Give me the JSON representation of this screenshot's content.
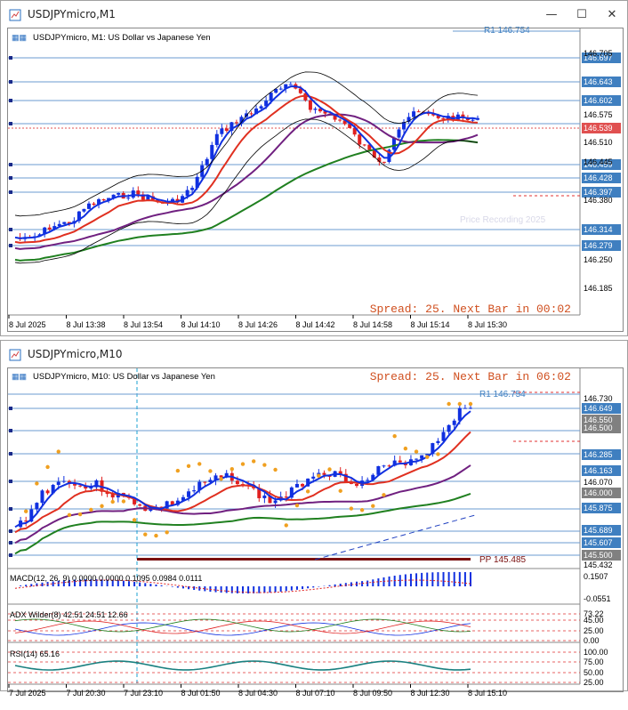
{
  "win1": {
    "title": "USDJPYmicro,M1",
    "chart_title": "USDJPYmicro, M1:  US Dollar vs Japanese Yen",
    "spread_label": "Spread: 25. Next Bar in 00:02",
    "r1_label": "R1 146.754",
    "watermark": "Price Recording 2025",
    "price_tags": [
      {
        "v": "146.697",
        "bg": "#3f7fc0"
      },
      {
        "v": "146.643",
        "bg": "#3f7fc0"
      },
      {
        "v": "146.602",
        "bg": "#3f7fc0"
      },
      {
        "v": "146.539",
        "bg": "#e05050"
      },
      {
        "v": "146.459",
        "bg": "#3f7fc0"
      },
      {
        "v": "146.428",
        "bg": "#3f7fc0"
      },
      {
        "v": "146.397",
        "bg": "#3f7fc0"
      },
      {
        "v": "146.314",
        "bg": "#3f7fc0"
      },
      {
        "v": "146.279",
        "bg": "#3f7fc0"
      }
    ],
    "y_ticks": [
      "146.705",
      "146.575",
      "146.510",
      "146.445",
      "146.380",
      "146.250",
      "146.185"
    ],
    "x_ticks": [
      "8 Jul 2025",
      "8 Jul 13:38",
      "8 Jul 13:54",
      "8 Jul 14:10",
      "8 Jul 14:26",
      "8 Jul 14:42",
      "8 Jul 14:58",
      "8 Jul 15:14",
      "8 Jul 15:30"
    ]
  },
  "win2": {
    "title": "USDJPYmicro,M10",
    "chart_title": "USDJPYmicro, M10:  US Dollar vs Japanese Yen",
    "spread_label": "Spread: 25. Next Bar in 06:02",
    "r1_label": "R1 146.754",
    "pp_label": "PP 145.485",
    "price_tags": [
      {
        "v": "146.649",
        "bg": "#3f7fc0"
      },
      {
        "v": "146.550",
        "bg": "#808080"
      },
      {
        "v": "146.500",
        "bg": "#808080"
      },
      {
        "v": "146.285",
        "bg": "#3f7fc0"
      },
      {
        "v": "146.163",
        "bg": "#3f7fc0"
      },
      {
        "v": "146.000",
        "bg": "#808080"
      },
      {
        "v": "145.875",
        "bg": "#3f7fc0"
      },
      {
        "v": "145.689",
        "bg": "#3f7fc0"
      },
      {
        "v": "145.607",
        "bg": "#3f7fc0"
      },
      {
        "v": "145.500",
        "bg": "#808080"
      }
    ],
    "y_ticks": [
      "146.730",
      "146.070",
      "145.432"
    ],
    "macd_label": "MACD(12, 26, 9) 0.0000 0.0000 0.1095 0.0984 0.0111",
    "macd_ticks": [
      "0.1507",
      "-0.0551"
    ],
    "adx_label": "ADX Wilder(8) 42.51 24.51 12.66",
    "adx_ticks": [
      "73.22",
      "45.00",
      "25.00",
      "0.00"
    ],
    "rsi_label": "RSI(14) 65.16",
    "rsi_ticks": [
      "100.00",
      "75.00",
      "50.00",
      "25.00"
    ],
    "x_ticks": [
      "7 Jul 2025",
      "7 Jul 20:30",
      "7 Jul 23:10",
      "8 Jul 01:50",
      "8 Jul 04:30",
      "8 Jul 07:10",
      "8 Jul 09:50",
      "8 Jul 12:30",
      "8 Jul 15:10"
    ]
  },
  "icons": {
    "app": "chart-app-icon",
    "minimize": "minimize-icon",
    "maximize": "maximize-icon",
    "close": "close-icon"
  },
  "colors": {
    "spread": "#d05020",
    "level": "#3f7fc0",
    "bull": "#1030e0",
    "bear": "#e02020"
  }
}
